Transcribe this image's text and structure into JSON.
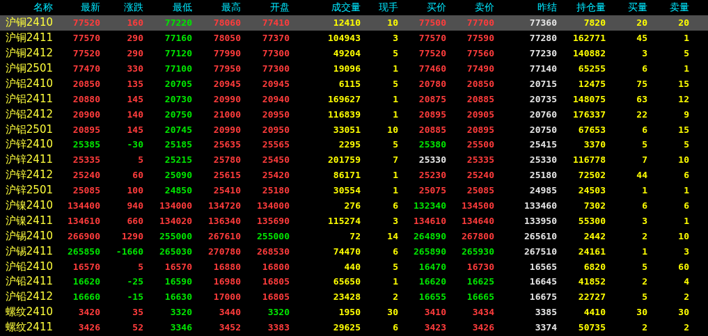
{
  "table": {
    "columns": [
      {
        "label": "名称",
        "kind": "name"
      },
      {
        "label": "最新",
        "kind": "price"
      },
      {
        "label": "涨跌",
        "kind": "price"
      },
      {
        "label": "最低",
        "kind": "price"
      },
      {
        "label": "最高",
        "kind": "price"
      },
      {
        "label": "开盘",
        "kind": "price"
      },
      {
        "label": "成交量",
        "kind": "volume"
      },
      {
        "label": "现手",
        "kind": "volume"
      },
      {
        "label": "买价",
        "kind": "price"
      },
      {
        "label": "卖价",
        "kind": "price"
      },
      {
        "label": "昨结",
        "kind": "settle"
      },
      {
        "label": "持仓量",
        "kind": "volume"
      },
      {
        "label": "买量",
        "kind": "volume"
      },
      {
        "label": "卖量",
        "kind": "volume"
      }
    ],
    "rows": [
      {
        "selected": true,
        "cells": [
          "沪铜2410",
          {
            "text": "77520",
            "color": "#ff3c3c"
          },
          {
            "text": "160",
            "color": "#ff3c3c"
          },
          {
            "text": "77220",
            "color": "#00e600"
          },
          {
            "text": "78060",
            "color": "#ff3c3c"
          },
          {
            "text": "77410",
            "color": "#ff3c3c"
          },
          "12410",
          "10",
          {
            "text": "77500",
            "color": "#ff3c3c"
          },
          {
            "text": "77700",
            "color": "#ff3c3c"
          },
          "77360",
          "7820",
          "20",
          "20"
        ]
      },
      {
        "selected": false,
        "cells": [
          "沪铜2411",
          {
            "text": "77570",
            "color": "#ff3c3c"
          },
          {
            "text": "290",
            "color": "#ff3c3c"
          },
          {
            "text": "77160",
            "color": "#00e600"
          },
          {
            "text": "78050",
            "color": "#ff3c3c"
          },
          {
            "text": "77370",
            "color": "#ff3c3c"
          },
          "104943",
          "3",
          {
            "text": "77570",
            "color": "#ff3c3c"
          },
          {
            "text": "77590",
            "color": "#ff3c3c"
          },
          "77280",
          "162771",
          "45",
          "1"
        ]
      },
      {
        "selected": false,
        "cells": [
          "沪铜2412",
          {
            "text": "77520",
            "color": "#ff3c3c"
          },
          {
            "text": "290",
            "color": "#ff3c3c"
          },
          {
            "text": "77120",
            "color": "#00e600"
          },
          {
            "text": "77990",
            "color": "#ff3c3c"
          },
          {
            "text": "77300",
            "color": "#ff3c3c"
          },
          "49204",
          "5",
          {
            "text": "77520",
            "color": "#ff3c3c"
          },
          {
            "text": "77560",
            "color": "#ff3c3c"
          },
          "77230",
          "140882",
          "3",
          "5"
        ]
      },
      {
        "selected": false,
        "cells": [
          "沪铜2501",
          {
            "text": "77470",
            "color": "#ff3c3c"
          },
          {
            "text": "330",
            "color": "#ff3c3c"
          },
          {
            "text": "77100",
            "color": "#00e600"
          },
          {
            "text": "77950",
            "color": "#ff3c3c"
          },
          {
            "text": "77300",
            "color": "#ff3c3c"
          },
          "19096",
          "1",
          {
            "text": "77460",
            "color": "#ff3c3c"
          },
          {
            "text": "77490",
            "color": "#ff3c3c"
          },
          "77140",
          "65255",
          "6",
          "1"
        ]
      },
      {
        "selected": false,
        "cells": [
          "沪铝2410",
          {
            "text": "20850",
            "color": "#ff3c3c"
          },
          {
            "text": "135",
            "color": "#ff3c3c"
          },
          {
            "text": "20705",
            "color": "#00e600"
          },
          {
            "text": "20945",
            "color": "#ff3c3c"
          },
          {
            "text": "20945",
            "color": "#ff3c3c"
          },
          "6115",
          "5",
          {
            "text": "20780",
            "color": "#ff3c3c"
          },
          {
            "text": "20850",
            "color": "#ff3c3c"
          },
          "20715",
          "12475",
          "75",
          "15"
        ]
      },
      {
        "selected": false,
        "cells": [
          "沪铝2411",
          {
            "text": "20880",
            "color": "#ff3c3c"
          },
          {
            "text": "145",
            "color": "#ff3c3c"
          },
          {
            "text": "20730",
            "color": "#00e600"
          },
          {
            "text": "20990",
            "color": "#ff3c3c"
          },
          {
            "text": "20940",
            "color": "#ff3c3c"
          },
          "169627",
          "1",
          {
            "text": "20875",
            "color": "#ff3c3c"
          },
          {
            "text": "20885",
            "color": "#ff3c3c"
          },
          "20735",
          "148075",
          "63",
          "12"
        ]
      },
      {
        "selected": false,
        "cells": [
          "沪铝2412",
          {
            "text": "20900",
            "color": "#ff3c3c"
          },
          {
            "text": "140",
            "color": "#ff3c3c"
          },
          {
            "text": "20750",
            "color": "#00e600"
          },
          {
            "text": "21000",
            "color": "#ff3c3c"
          },
          {
            "text": "20950",
            "color": "#ff3c3c"
          },
          "116839",
          "1",
          {
            "text": "20895",
            "color": "#ff3c3c"
          },
          {
            "text": "20905",
            "color": "#ff3c3c"
          },
          "20760",
          "176337",
          "22",
          "9"
        ]
      },
      {
        "selected": false,
        "cells": [
          "沪铝2501",
          {
            "text": "20895",
            "color": "#ff3c3c"
          },
          {
            "text": "145",
            "color": "#ff3c3c"
          },
          {
            "text": "20745",
            "color": "#00e600"
          },
          {
            "text": "20990",
            "color": "#ff3c3c"
          },
          {
            "text": "20950",
            "color": "#ff3c3c"
          },
          "33051",
          "10",
          {
            "text": "20885",
            "color": "#ff3c3c"
          },
          {
            "text": "20895",
            "color": "#ff3c3c"
          },
          "20750",
          "67653",
          "6",
          "15"
        ]
      },
      {
        "selected": false,
        "cells": [
          "沪锌2410",
          {
            "text": "25385",
            "color": "#00e600"
          },
          {
            "text": "-30",
            "color": "#00e600"
          },
          {
            "text": "25185",
            "color": "#00e600"
          },
          {
            "text": "25635",
            "color": "#ff3c3c"
          },
          {
            "text": "25565",
            "color": "#ff3c3c"
          },
          "2295",
          "5",
          {
            "text": "25380",
            "color": "#00e600"
          },
          {
            "text": "25500",
            "color": "#ff3c3c"
          },
          "25415",
          "3370",
          "5",
          "5"
        ]
      },
      {
        "selected": false,
        "cells": [
          "沪锌2411",
          {
            "text": "25335",
            "color": "#ff3c3c"
          },
          {
            "text": "5",
            "color": "#ff3c3c"
          },
          {
            "text": "25215",
            "color": "#00e600"
          },
          {
            "text": "25780",
            "color": "#ff3c3c"
          },
          {
            "text": "25450",
            "color": "#ff3c3c"
          },
          "201759",
          "7",
          {
            "text": "25330",
            "color": "#e6e6e6"
          },
          {
            "text": "25335",
            "color": "#ff3c3c"
          },
          "25330",
          "116778",
          "7",
          "10"
        ]
      },
      {
        "selected": false,
        "cells": [
          "沪锌2412",
          {
            "text": "25240",
            "color": "#ff3c3c"
          },
          {
            "text": "60",
            "color": "#ff3c3c"
          },
          {
            "text": "25090",
            "color": "#00e600"
          },
          {
            "text": "25615",
            "color": "#ff3c3c"
          },
          {
            "text": "25420",
            "color": "#ff3c3c"
          },
          "86171",
          "1",
          {
            "text": "25230",
            "color": "#ff3c3c"
          },
          {
            "text": "25240",
            "color": "#ff3c3c"
          },
          "25180",
          "72502",
          "44",
          "6"
        ]
      },
      {
        "selected": false,
        "cells": [
          "沪锌2501",
          {
            "text": "25085",
            "color": "#ff3c3c"
          },
          {
            "text": "100",
            "color": "#ff3c3c"
          },
          {
            "text": "24850",
            "color": "#00e600"
          },
          {
            "text": "25410",
            "color": "#ff3c3c"
          },
          {
            "text": "25180",
            "color": "#ff3c3c"
          },
          "30554",
          "1",
          {
            "text": "25075",
            "color": "#ff3c3c"
          },
          {
            "text": "25085",
            "color": "#ff3c3c"
          },
          "24985",
          "24503",
          "1",
          "1"
        ]
      },
      {
        "selected": false,
        "cells": [
          "沪镍2410",
          {
            "text": "134400",
            "color": "#ff3c3c"
          },
          {
            "text": "940",
            "color": "#ff3c3c"
          },
          {
            "text": "134000",
            "color": "#ff3c3c"
          },
          {
            "text": "134720",
            "color": "#ff3c3c"
          },
          {
            "text": "134000",
            "color": "#ff3c3c"
          },
          "276",
          "6",
          {
            "text": "132340",
            "color": "#00e600"
          },
          {
            "text": "134500",
            "color": "#ff3c3c"
          },
          "133460",
          "7302",
          "6",
          "6"
        ]
      },
      {
        "selected": false,
        "cells": [
          "沪镍2411",
          {
            "text": "134610",
            "color": "#ff3c3c"
          },
          {
            "text": "660",
            "color": "#ff3c3c"
          },
          {
            "text": "134020",
            "color": "#ff3c3c"
          },
          {
            "text": "136340",
            "color": "#ff3c3c"
          },
          {
            "text": "135690",
            "color": "#ff3c3c"
          },
          "115274",
          "3",
          {
            "text": "134610",
            "color": "#ff3c3c"
          },
          {
            "text": "134640",
            "color": "#ff3c3c"
          },
          "133950",
          "55300",
          "3",
          "1"
        ]
      },
      {
        "selected": false,
        "cells": [
          "沪锡2410",
          {
            "text": "266900",
            "color": "#ff3c3c"
          },
          {
            "text": "1290",
            "color": "#ff3c3c"
          },
          {
            "text": "255000",
            "color": "#00e600"
          },
          {
            "text": "267610",
            "color": "#ff3c3c"
          },
          {
            "text": "255000",
            "color": "#00e600"
          },
          "72",
          "14",
          {
            "text": "264890",
            "color": "#00e600"
          },
          {
            "text": "267800",
            "color": "#ff3c3c"
          },
          "265610",
          "2442",
          "2",
          "10"
        ]
      },
      {
        "selected": false,
        "cells": [
          "沪锡2411",
          {
            "text": "265850",
            "color": "#00e600"
          },
          {
            "text": "-1660",
            "color": "#00e600"
          },
          {
            "text": "265030",
            "color": "#00e600"
          },
          {
            "text": "270780",
            "color": "#ff3c3c"
          },
          {
            "text": "268530",
            "color": "#ff3c3c"
          },
          "74470",
          "6",
          {
            "text": "265890",
            "color": "#00e600"
          },
          {
            "text": "265930",
            "color": "#00e600"
          },
          "267510",
          "24161",
          "1",
          "3"
        ]
      },
      {
        "selected": false,
        "cells": [
          "沪铅2410",
          {
            "text": "16570",
            "color": "#ff3c3c"
          },
          {
            "text": "5",
            "color": "#ff3c3c"
          },
          {
            "text": "16570",
            "color": "#ff3c3c"
          },
          {
            "text": "16880",
            "color": "#ff3c3c"
          },
          {
            "text": "16800",
            "color": "#ff3c3c"
          },
          "440",
          "5",
          {
            "text": "16470",
            "color": "#00e600"
          },
          {
            "text": "16730",
            "color": "#ff3c3c"
          },
          "16565",
          "6820",
          "5",
          "60"
        ]
      },
      {
        "selected": false,
        "cells": [
          "沪铅2411",
          {
            "text": "16620",
            "color": "#00e600"
          },
          {
            "text": "-25",
            "color": "#00e600"
          },
          {
            "text": "16590",
            "color": "#00e600"
          },
          {
            "text": "16980",
            "color": "#ff3c3c"
          },
          {
            "text": "16805",
            "color": "#ff3c3c"
          },
          "65650",
          "1",
          {
            "text": "16620",
            "color": "#00e600"
          },
          {
            "text": "16625",
            "color": "#00e600"
          },
          "16645",
          "41852",
          "2",
          "4"
        ]
      },
      {
        "selected": false,
        "cells": [
          "沪铅2412",
          {
            "text": "16660",
            "color": "#00e600"
          },
          {
            "text": "-15",
            "color": "#00e600"
          },
          {
            "text": "16630",
            "color": "#00e600"
          },
          {
            "text": "17000",
            "color": "#ff3c3c"
          },
          {
            "text": "16805",
            "color": "#ff3c3c"
          },
          "23428",
          "2",
          {
            "text": "16655",
            "color": "#00e600"
          },
          {
            "text": "16665",
            "color": "#00e600"
          },
          "16675",
          "22727",
          "5",
          "2"
        ]
      },
      {
        "selected": false,
        "cells": [
          "螺纹2410",
          {
            "text": "3420",
            "color": "#ff3c3c"
          },
          {
            "text": "35",
            "color": "#ff3c3c"
          },
          {
            "text": "3320",
            "color": "#00e600"
          },
          {
            "text": "3440",
            "color": "#ff3c3c"
          },
          {
            "text": "3320",
            "color": "#00e600"
          },
          "1950",
          "30",
          {
            "text": "3410",
            "color": "#ff3c3c"
          },
          {
            "text": "3434",
            "color": "#ff3c3c"
          },
          "3385",
          "4410",
          "30",
          "30"
        ]
      },
      {
        "selected": false,
        "cells": [
          "螺纹2411",
          {
            "text": "3426",
            "color": "#ff3c3c"
          },
          {
            "text": "52",
            "color": "#ff3c3c"
          },
          {
            "text": "3346",
            "color": "#00e600"
          },
          {
            "text": "3452",
            "color": "#ff3c3c"
          },
          {
            "text": "3383",
            "color": "#ff3c3c"
          },
          "29625",
          "6",
          {
            "text": "3423",
            "color": "#ff3c3c"
          },
          {
            "text": "3426",
            "color": "#ff3c3c"
          },
          "3374",
          "50735",
          "2",
          "2"
        ]
      }
    ]
  }
}
